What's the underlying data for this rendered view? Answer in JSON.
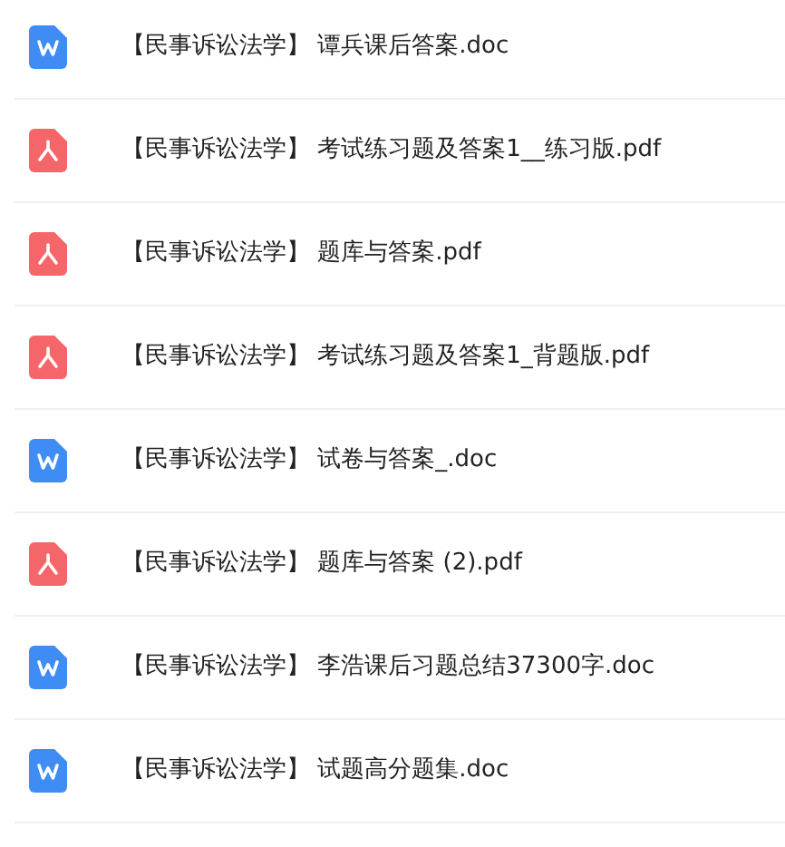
{
  "files": [
    {
      "kind": "doc",
      "name": "【民事诉讼法学】 谭兵课后答案.doc"
    },
    {
      "kind": "pdf",
      "name": "【民事诉讼法学】 考试练习题及答案1__练习版.pdf"
    },
    {
      "kind": "pdf",
      "name": "【民事诉讼法学】 题库与答案.pdf"
    },
    {
      "kind": "pdf",
      "name": "【民事诉讼法学】 考试练习题及答案1_背题版.pdf"
    },
    {
      "kind": "doc",
      "name": "【民事诉讼法学】 试卷与答案_.doc"
    },
    {
      "kind": "pdf",
      "name": "【民事诉讼法学】 题库与答案 (2).pdf"
    },
    {
      "kind": "doc",
      "name": "【民事诉讼法学】 李浩课后习题总结37300字.doc"
    },
    {
      "kind": "doc",
      "name": "【民事诉讼法学】 试题高分题集.doc"
    }
  ]
}
